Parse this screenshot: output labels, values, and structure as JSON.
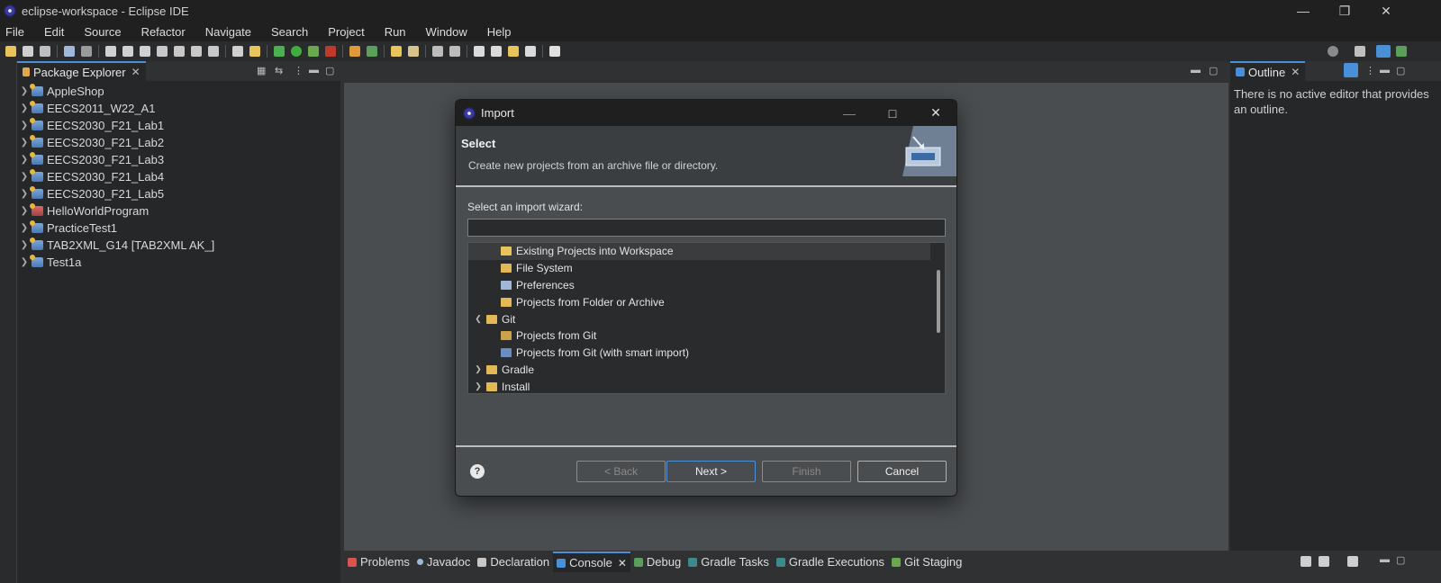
{
  "window": {
    "title": "eclipse-workspace - Eclipse IDE"
  },
  "menu": [
    "File",
    "Edit",
    "Source",
    "Refactor",
    "Navigate",
    "Search",
    "Project",
    "Run",
    "Window",
    "Help"
  ],
  "package_explorer": {
    "tab_label": "Package Explorer",
    "projects": [
      "AppleShop",
      "EECS2011_W22_A1",
      "EECS2030_F21_Lab1",
      "EECS2030_F21_Lab2",
      "EECS2030_F21_Lab3",
      "EECS2030_F21_Lab4",
      "EECS2030_F21_Lab5",
      "HelloWorldProgram",
      "PracticeTest1",
      "TAB2XML_G14 [TAB2XML AK_]",
      "Test1a"
    ]
  },
  "outline": {
    "tab_label": "Outline",
    "message": "There is no active editor that provides an outline."
  },
  "bottom_tabs": [
    "Problems",
    "Javadoc",
    "Declaration",
    "Console",
    "Debug",
    "Gradle Tasks",
    "Gradle Executions",
    "Git Staging"
  ],
  "dialog": {
    "title": "Import",
    "heading": "Select",
    "description": "Create new projects from an archive file or directory.",
    "wizard_label": "Select an import wizard:",
    "filter_value": "",
    "wizards": [
      {
        "label": "Existing Projects into Workspace",
        "level": 2
      },
      {
        "label": "File System",
        "level": 2
      },
      {
        "label": "Preferences",
        "level": 2
      },
      {
        "label": "Projects from Folder or Archive",
        "level": 2
      },
      {
        "label": "Git",
        "level": 1,
        "expanded": true
      },
      {
        "label": "Projects from Git",
        "level": 2
      },
      {
        "label": "Projects from Git (with smart import)",
        "level": 2
      },
      {
        "label": "Gradle",
        "level": 1,
        "expanded": false
      },
      {
        "label": "Install",
        "level": 1,
        "expanded": false
      }
    ],
    "buttons": {
      "back": "< Back",
      "next": "Next >",
      "finish": "Finish",
      "cancel": "Cancel"
    },
    "help_icon": "?"
  },
  "colors": {
    "accent": "#4a90d9",
    "dialog_bg": "#4a4d50",
    "tree_bg": "#2a2b2c"
  }
}
